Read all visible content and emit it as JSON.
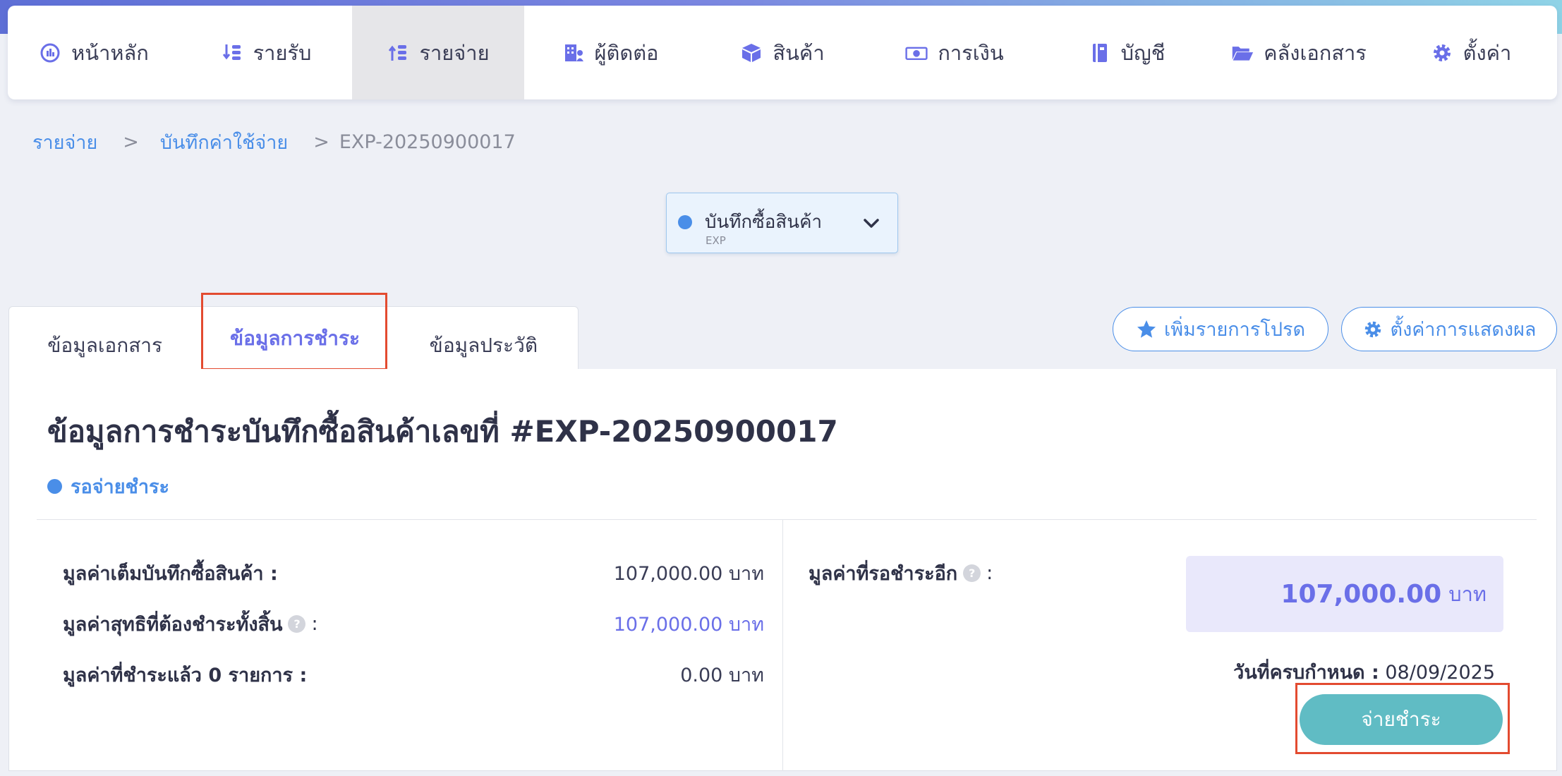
{
  "nav": {
    "items": [
      {
        "label": "หน้าหลัก",
        "icon": "dashboard-gauge-icon"
      },
      {
        "label": "รายรับ",
        "icon": "income-arrows-coins-icon"
      },
      {
        "label": "รายจ่าย",
        "icon": "expense-arrows-coins-icon"
      },
      {
        "label": "ผู้ติดต่อ",
        "icon": "contacts-building-icon"
      },
      {
        "label": "สินค้า",
        "icon": "product-box-icon"
      },
      {
        "label": "การเงิน",
        "icon": "money-bill-icon"
      },
      {
        "label": "บัญชี",
        "icon": "account-book-icon"
      },
      {
        "label": "คลังเอกสาร",
        "icon": "folder-open-icon"
      },
      {
        "label": "ตั้งค่า",
        "icon": "gear-icon"
      }
    ],
    "active_index": 2
  },
  "breadcrumb": {
    "level1": "รายจ่าย",
    "level2": "บันทึกค่าใช้จ่าย",
    "current": "EXP-20250900017",
    "separator": ">"
  },
  "doc_type": {
    "label": "บันทึกซื้อสินค้า",
    "code": "EXP"
  },
  "tabs": {
    "doc_info": "ข้อมูลเอกสาร",
    "payment_info": "ข้อมูลการชำระ",
    "history": "ข้อมูลประวัติ"
  },
  "actions": {
    "favorite": "เพิ่มรายการโปรด",
    "display_settings": "ตั้งค่าการแสดงผล"
  },
  "payment": {
    "title": "ข้อมูลการชำระบันทึกซื้อสินค้าเลขที่ #EXP-20250900017",
    "status": "รอจ่ายชำระ",
    "full_value_label": "มูลค่าเต็มบันทึกซื้อสินค้า :",
    "full_value": "107,000.00 บาท",
    "net_value_label": "มูลค่าสุทธิที่ต้องชำระทั้งสิ้น",
    "net_value": "107,000.00 บาท",
    "paid_label": "มูลค่าที่ชำระแล้ว 0 รายการ :",
    "paid_value": "0.00 บาท",
    "remaining_label": "มูลค่าที่รอชำระอีก",
    "remaining_amount": "107,000.00",
    "remaining_unit": "บาท",
    "due_label": "วันที่ครบกำหนด :",
    "due_date": "08/09/2025",
    "pay_button": "จ่ายชำระ",
    "help_symbol": "?",
    "colon": ":"
  },
  "colors": {
    "accent_blue": "#4a8ee8",
    "accent_purple": "#6a6fe8",
    "pay_button": "#60bcc4",
    "highlight": "#e34b30"
  }
}
